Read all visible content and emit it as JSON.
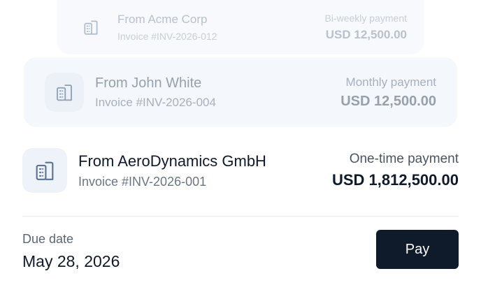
{
  "invoices": [
    {
      "from": "From Acme Corp",
      "invoice": "Invoice #INV-2026-012",
      "payment_type": "Bi-weekly payment",
      "amount": "USD 12,500.00",
      "icon": "building-icon"
    },
    {
      "from": "From John White",
      "invoice": "Invoice #INV-2026-004",
      "payment_type": "Monthly payment",
      "amount": "USD 12,500.00",
      "icon": "building-icon"
    },
    {
      "from": "From AeroDynamics GmbH",
      "invoice": "Invoice #INV-2026-001",
      "payment_type": "One-time payment",
      "amount": "USD 1,812,500.00",
      "icon": "building-icon"
    }
  ],
  "due": {
    "label": "Due date",
    "value": "May 28, 2026"
  },
  "pay_button": {
    "label": "Pay"
  },
  "colors": {
    "primary_dark": "#0f1b2b",
    "icon_stroke": "#5a7390",
    "icon_tile_bg": "#eef3f9"
  }
}
